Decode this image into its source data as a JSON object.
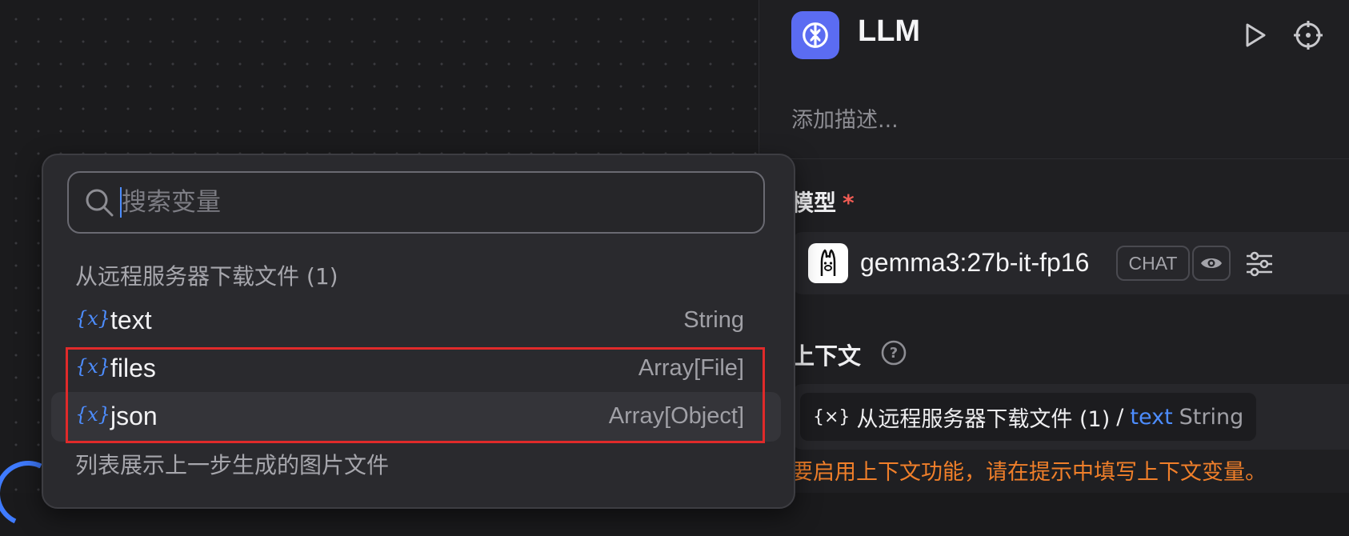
{
  "node": {
    "title": "LLM",
    "description_placeholder": "添加描述..."
  },
  "model_section": {
    "label": "模型",
    "required_mark": "*",
    "model_name": "gemma3:27b-it-fp16",
    "badge": "CHAT"
  },
  "context_section": {
    "label": "上下文",
    "chip": {
      "icon_text": "{×}",
      "source": "从远程服务器下载文件 (1)",
      "separator": "/",
      "variable": "text",
      "type": "String"
    },
    "warning": "要启用上下文功能，请在提示中填写上下文变量。"
  },
  "variable_picker": {
    "search_placeholder": "搜索变量",
    "group_title": "从远程服务器下载文件 (1)",
    "items": [
      {
        "icon": "{x}",
        "name": "text",
        "type": "String"
      },
      {
        "icon": "{x}",
        "name": "files",
        "type": "Array[File]"
      },
      {
        "icon": "{x}",
        "name": "json",
        "type": "Array[Object]"
      }
    ],
    "footer_note": "列表展示上一步生成的图片文件"
  },
  "colors": {
    "accent": "#4d8dff",
    "node_icon_bg": "#5b6cf2",
    "warning": "#f07f2a",
    "highlight_box": "#e02a2a",
    "required": "#f25c54"
  }
}
